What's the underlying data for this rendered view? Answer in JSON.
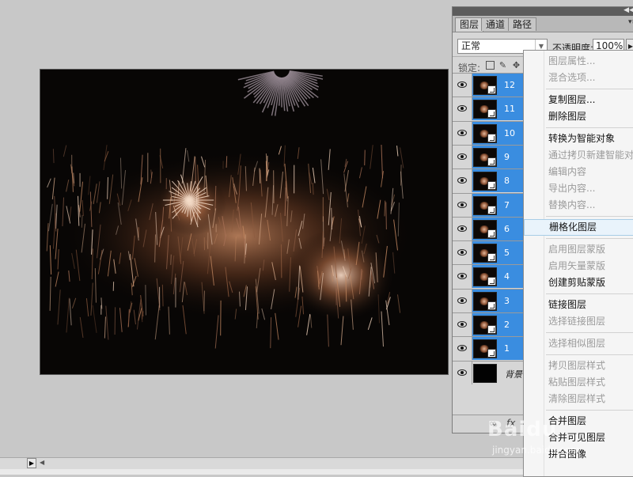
{
  "panel": {
    "tabs": [
      "图层",
      "通道",
      "路径"
    ],
    "blend_mode": "正常",
    "opacity_label": "不透明度:",
    "opacity_value": "100%",
    "lock_label": "锁定:"
  },
  "layers": [
    {
      "name": "12",
      "selected": true
    },
    {
      "name": "11",
      "selected": true
    },
    {
      "name": "10",
      "selected": true
    },
    {
      "name": "9",
      "selected": true
    },
    {
      "name": "8",
      "selected": true
    },
    {
      "name": "7",
      "selected": true
    },
    {
      "name": "6",
      "selected": true
    },
    {
      "name": "5",
      "selected": true
    },
    {
      "name": "4",
      "selected": true
    },
    {
      "name": "3",
      "selected": true
    },
    {
      "name": "2",
      "selected": true
    },
    {
      "name": "1",
      "selected": true
    },
    {
      "name": "背景",
      "selected": false,
      "background": true
    }
  ],
  "context_menu": {
    "items": [
      {
        "label": "图层属性...",
        "enabled": false
      },
      {
        "label": "混合选项...",
        "enabled": false
      },
      {
        "sep": true
      },
      {
        "label": "复制图层...",
        "enabled": true
      },
      {
        "label": "删除图层",
        "enabled": true
      },
      {
        "sep": true
      },
      {
        "label": "转换为智能对象",
        "enabled": true
      },
      {
        "label": "通过拷贝新建智能对象",
        "enabled": false
      },
      {
        "label": "编辑内容",
        "enabled": false
      },
      {
        "label": "导出内容...",
        "enabled": false
      },
      {
        "label": "替换内容...",
        "enabled": false
      },
      {
        "sep": true
      },
      {
        "label": "栅格化图层",
        "enabled": true,
        "hover": true
      },
      {
        "sep": true
      },
      {
        "label": "启用图层蒙版",
        "enabled": false
      },
      {
        "label": "启用矢量蒙版",
        "enabled": false
      },
      {
        "label": "创建剪贴蒙版",
        "enabled": true
      },
      {
        "sep": true
      },
      {
        "label": "链接图层",
        "enabled": true
      },
      {
        "label": "选择链接图层",
        "enabled": false
      },
      {
        "sep": true
      },
      {
        "label": "选择相似图层",
        "enabled": false
      },
      {
        "sep": true
      },
      {
        "label": "拷贝图层样式",
        "enabled": false
      },
      {
        "label": "粘贴图层样式",
        "enabled": false
      },
      {
        "label": "清除图层样式",
        "enabled": false
      },
      {
        "sep": true
      },
      {
        "label": "合并图层",
        "enabled": true
      },
      {
        "label": "合并可见图层",
        "enabled": true
      },
      {
        "label": "拼合图像",
        "enabled": true
      }
    ]
  },
  "watermark": {
    "brand": "Baidu",
    "sub": "jingyan.baidu.com"
  },
  "icons": {
    "eye": "eye-icon",
    "smart_object": "smart-object-icon",
    "lock_transparent": "lock-transparent-icon",
    "lock_image": "brush-icon",
    "lock_position": "move-icon"
  },
  "colors": {
    "selected_row": "#3a8de0",
    "menu_hover": "#e9f3fb"
  }
}
